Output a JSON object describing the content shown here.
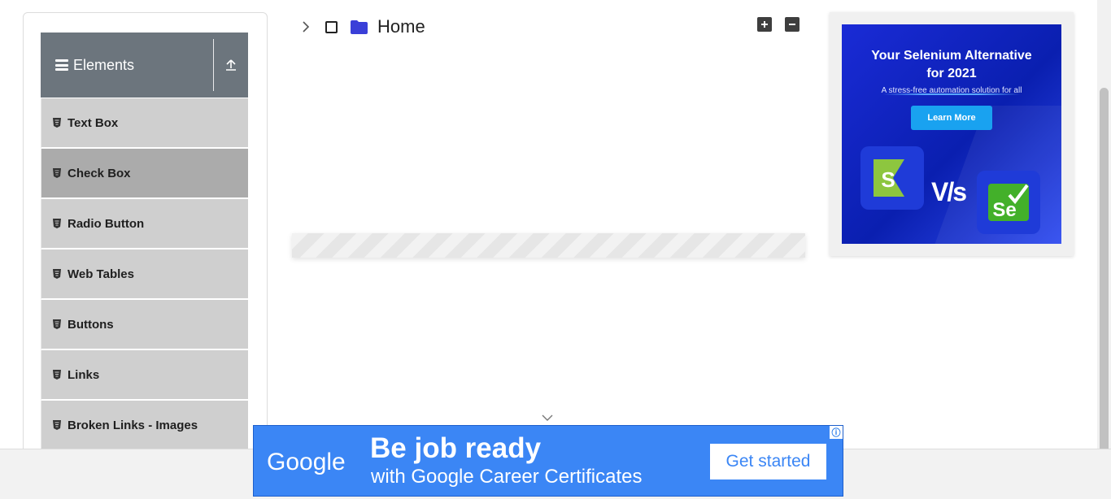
{
  "sidebar": {
    "group_title": "Elements",
    "items": [
      {
        "label": "Text Box"
      },
      {
        "label": "Check Box"
      },
      {
        "label": "Radio Button"
      },
      {
        "label": "Web Tables"
      },
      {
        "label": "Buttons"
      },
      {
        "label": "Links"
      },
      {
        "label": "Broken Links - Images"
      }
    ],
    "active_item": "Check Box"
  },
  "tree": {
    "root_label": "Home",
    "expanded": false,
    "checked": false,
    "folder_color": "#3a3fd8"
  },
  "ad_right": {
    "title_line1": "Your Selenium Alternative",
    "title_line2": "for 2021",
    "subtitle": "A stress-free automation solution for all",
    "cta": "Learn More",
    "vs_text": "V/s",
    "logo_left_letter": "S",
    "logo_right_letter": "Se"
  },
  "ad_bottom": {
    "brand": "Google",
    "headline": "Be job ready",
    "subline": "with Google Career Certificates",
    "cta": "Get started",
    "info_glyph": "ⓘ"
  },
  "colors": {
    "sidebar_header": "#6c757d",
    "menu_item": "#cfcfcf",
    "menu_item_active": "#ababab",
    "google_ad_bg": "#3b86f5"
  }
}
